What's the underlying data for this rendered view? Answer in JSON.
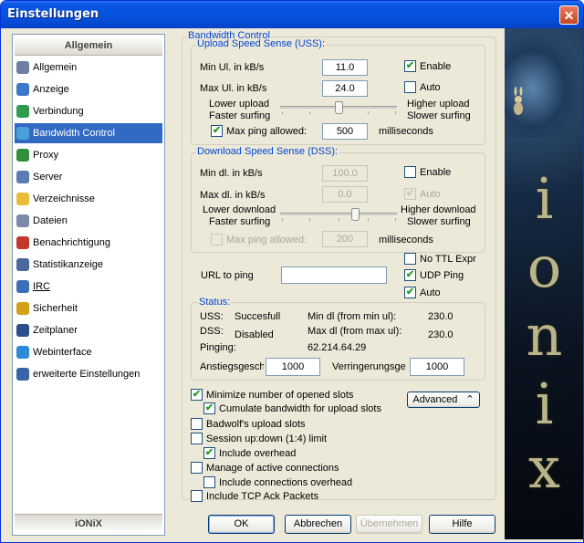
{
  "window": {
    "title": "Einstellungen",
    "close_symbol": "✕"
  },
  "nav": {
    "header": "Allgemein",
    "footer": "iONiX",
    "items": [
      {
        "label": "Allgemein",
        "icon": "gear-icon",
        "color": "#6d7fa3"
      },
      {
        "label": "Anzeige",
        "icon": "monitor-icon",
        "color": "#3b79c9"
      },
      {
        "label": "Verbindung",
        "icon": "network-icon",
        "color": "#2e9b4f"
      },
      {
        "label": "Bandwidth Control",
        "icon": "network-icon",
        "color": "#4aa0d8"
      },
      {
        "label": "Proxy",
        "icon": "proxy-icon",
        "color": "#2f8f3a"
      },
      {
        "label": "Server",
        "icon": "server-icon",
        "color": "#5a7bb3"
      },
      {
        "label": "Verzeichnisse",
        "icon": "folder-icon",
        "color": "#e8bd3a"
      },
      {
        "label": "Dateien",
        "icon": "file-icon",
        "color": "#7a8aa8"
      },
      {
        "label": "Benachrichtigung",
        "icon": "notification-icon",
        "color": "#c0392b"
      },
      {
        "label": "Statistikanzeige",
        "icon": "chart-icon",
        "color": "#4a67a0"
      },
      {
        "label": "IRC",
        "icon": "irc-icon",
        "color": "#3a6fb7"
      },
      {
        "label": "Sicherheit",
        "icon": "lock-icon",
        "color": "#d4a017"
      },
      {
        "label": "Zeitplaner",
        "icon": "clock-icon",
        "color": "#2b4f8c"
      },
      {
        "label": "Webinterface",
        "icon": "globe-icon",
        "color": "#2c8ad6"
      },
      {
        "label": "erweiterte Einstellungen",
        "icon": "settings-icon",
        "color": "#3965a8"
      }
    ],
    "selected_index": 3
  },
  "bandwidth": {
    "title": "Bandwidth Control",
    "uss": {
      "title": "Upload Speed Sense (USS):",
      "min_label": "Min Ul. in kB/s",
      "min_value": "11.0",
      "max_label": "Max Ul. in kB/s",
      "max_value": "24.0",
      "enable_label": "Enable",
      "enable_checked": "✔",
      "auto_label": "Auto",
      "lower_line1": "Lower upload",
      "lower_line2": "Faster surfing",
      "higher_line1": "Higher upload",
      "higher_line2": "Slower surfing",
      "maxping_label": "Max ping allowed:",
      "maxping_checked": "✔",
      "maxping_value": "500",
      "maxping_unit": "milliseconds"
    },
    "dss": {
      "title": "Download Speed Sense (DSS):",
      "min_label": "Min dl. in kB/s",
      "min_value": "100.0",
      "max_label": "Max dl. in kB/s",
      "max_value": "0.0",
      "enable_label": "Enable",
      "auto_label": "Auto",
      "auto_checked": "✔",
      "lower_line1": "Lower download",
      "lower_line2": "Faster surfing",
      "higher_line1": "Higher download",
      "higher_line2": "Slower surfing",
      "maxping_label": "Max ping allowed:",
      "maxping_value": "200",
      "maxping_unit": "milliseconds"
    },
    "ping": {
      "url_label": "URL to ping",
      "url_value": "",
      "no_ttl_label": "No TTL Expr",
      "udp_label": "UDP Ping",
      "udp_checked": "✔",
      "auto_label": "Auto",
      "auto_checked": "✔"
    },
    "status": {
      "title": "Status:",
      "uss_label": "USS:",
      "uss_value": "Succesfull",
      "dss_label": "DSS:",
      "dss_value": "Disabled",
      "pinging_label": "Pinging:",
      "pinging_value": "62.214.64.29",
      "mindl_label": "Min dl  (from min ul):",
      "mindl_value": "230.0",
      "maxdl_label": "Max dl  (from max ul):",
      "maxdl_value": "230.0",
      "anstieg_label": "Anstiegsgesch",
      "anstieg_value": "1000",
      "verringerung_label": "Verringerungsge",
      "verringerung_value": "1000"
    },
    "options": {
      "minimize_label": "Minimize number of opened slots",
      "minimize_checked": "✔",
      "cumulate_label": "Cumulate bandwidth for upload slots",
      "cumulate_checked": "✔",
      "advanced_label": "Advanced",
      "advanced_symbol": "⌃",
      "badwolf_label": "Badwolf's upload slots",
      "session_label": "Session up:down (1:4) limit",
      "overhead_label": "Include overhead",
      "overhead_checked": "✔",
      "manage_label": "Manage of active connections",
      "conn_overhead_label": "Include connections overhead",
      "tcp_ack_label": "Include TCP Ack Packets"
    }
  },
  "buttons": {
    "ok": "OK",
    "cancel": "Abbrechen",
    "apply": "Übernehmen",
    "help": "Hilfe"
  },
  "art": {
    "letters": [
      "i",
      "o",
      "n",
      "i",
      "x"
    ]
  }
}
